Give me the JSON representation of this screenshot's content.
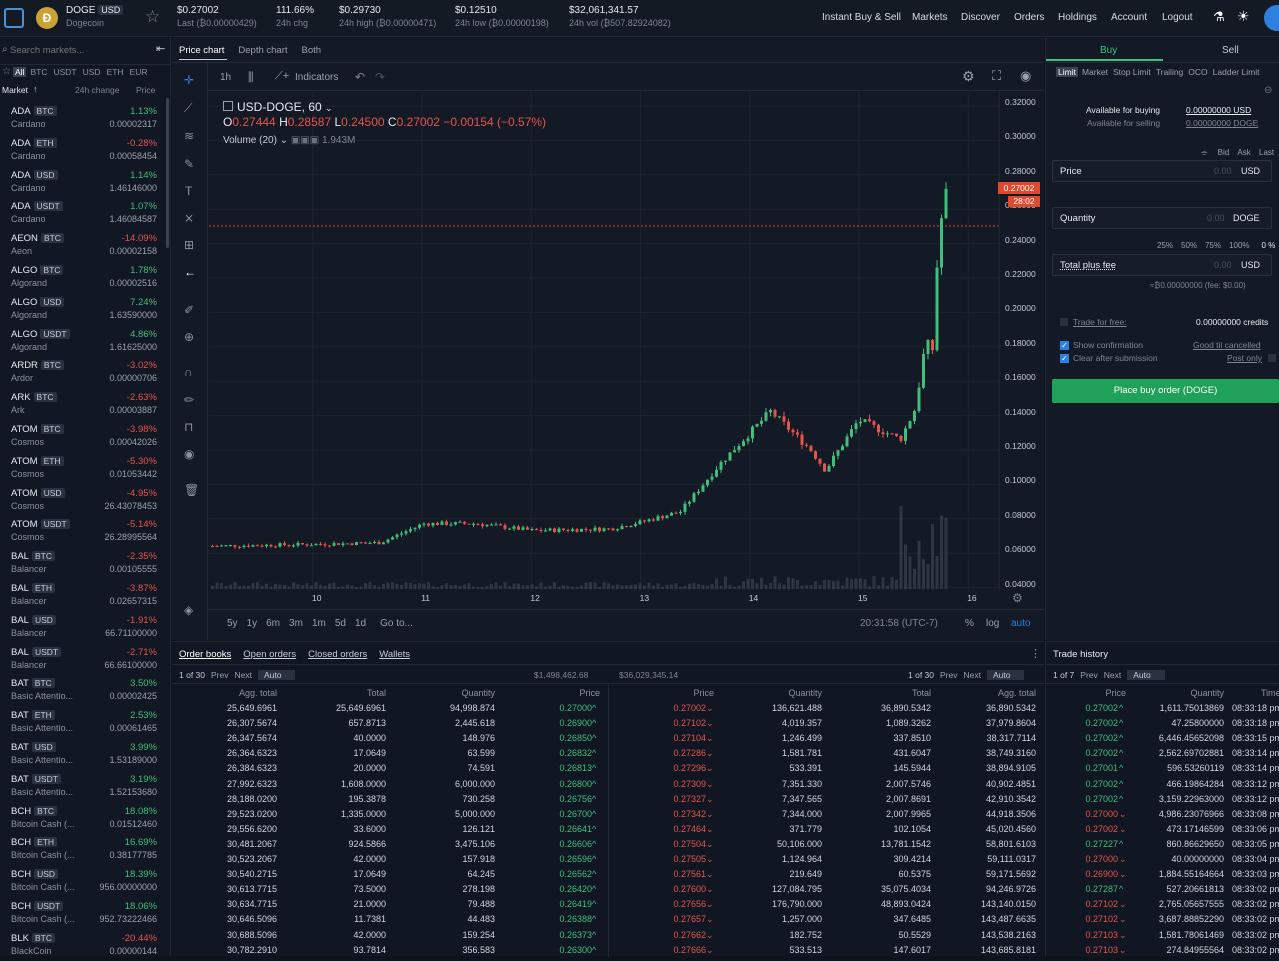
{
  "top": {
    "pair": "DOGE",
    "quote": "USD",
    "coin": "Dogecoin",
    "price": "$0.27002",
    "price_sub": "Last (₿0.00000429)",
    "chg": "111.66%",
    "chg_sub": "24h chg",
    "high": "$0.29730",
    "high_sub": "24h high (₿0.00000471)",
    "low": "$0.12510",
    "low_sub": "24h low (₿0.00000198)",
    "vol": "$32,061,341.57",
    "vol_sub": "24h vol (₿507.82924082)",
    "nav": [
      "Instant Buy & Sell",
      "Markets",
      "Discover",
      "Orders",
      "Holdings",
      "Account",
      "Logout"
    ]
  },
  "left": {
    "search_placeholder": "Search markets...",
    "filters": [
      "All",
      "BTC",
      "USDT",
      "USD",
      "ETH",
      "EUR"
    ],
    "col_market": "Market",
    "col_chg": "24h change",
    "col_price": "Price",
    "markets": [
      {
        "sym": "ADA",
        "q": "BTC",
        "name": "Cardano",
        "chg": "1.13%",
        "price": "0.00002317",
        "up": true
      },
      {
        "sym": "ADA",
        "q": "ETH",
        "name": "Cardano",
        "chg": "-0.28%",
        "price": "0.00058454",
        "up": false
      },
      {
        "sym": "ADA",
        "q": "USD",
        "name": "Cardano",
        "chg": "1.14%",
        "price": "1.46146000",
        "up": true
      },
      {
        "sym": "ADA",
        "q": "USDT",
        "name": "Cardano",
        "chg": "1.07%",
        "price": "1.46084587",
        "up": true
      },
      {
        "sym": "AEON",
        "q": "BTC",
        "name": "Aeon",
        "chg": "-14.09%",
        "price": "0.00002158",
        "up": false
      },
      {
        "sym": "ALGO",
        "q": "BTC",
        "name": "Algorand",
        "chg": "1.78%",
        "price": "0.00002516",
        "up": true
      },
      {
        "sym": "ALGO",
        "q": "USD",
        "name": "Algorand",
        "chg": "7.24%",
        "price": "1.63590000",
        "up": true
      },
      {
        "sym": "ALGO",
        "q": "USDT",
        "name": "Algorand",
        "chg": "4.86%",
        "price": "1.61625000",
        "up": true
      },
      {
        "sym": "ARDR",
        "q": "BTC",
        "name": "Ardor",
        "chg": "-3.02%",
        "price": "0.00000706",
        "up": false
      },
      {
        "sym": "ARK",
        "q": "BTC",
        "name": "Ark",
        "chg": "-2.63%",
        "price": "0.00003887",
        "up": false
      },
      {
        "sym": "ATOM",
        "q": "BTC",
        "name": "Cosmos",
        "chg": "-3.98%",
        "price": "0.00042026",
        "up": false
      },
      {
        "sym": "ATOM",
        "q": "ETH",
        "name": "Cosmos",
        "chg": "-5.30%",
        "price": "0.01053442",
        "up": false
      },
      {
        "sym": "ATOM",
        "q": "USD",
        "name": "Cosmos",
        "chg": "-4.95%",
        "price": "26.43078453",
        "up": false
      },
      {
        "sym": "ATOM",
        "q": "USDT",
        "name": "Cosmos",
        "chg": "-5.14%",
        "price": "26.28995564",
        "up": false
      },
      {
        "sym": "BAL",
        "q": "BTC",
        "name": "Balancer",
        "chg": "-2.35%",
        "price": "0.00105555",
        "up": false
      },
      {
        "sym": "BAL",
        "q": "ETH",
        "name": "Balancer",
        "chg": "-3.87%",
        "price": "0.02657315",
        "up": false
      },
      {
        "sym": "BAL",
        "q": "USD",
        "name": "Balancer",
        "chg": "-1.91%",
        "price": "66.71100000",
        "up": false
      },
      {
        "sym": "BAL",
        "q": "USDT",
        "name": "Balancer",
        "chg": "-2.71%",
        "price": "66.66100000",
        "up": false
      },
      {
        "sym": "BAT",
        "q": "BTC",
        "name": "Basic Attentio...",
        "chg": "3.50%",
        "price": "0.00002425",
        "up": true
      },
      {
        "sym": "BAT",
        "q": "ETH",
        "name": "Basic Attentio...",
        "chg": "2.53%",
        "price": "0.00061465",
        "up": true
      },
      {
        "sym": "BAT",
        "q": "USD",
        "name": "Basic Attentio...",
        "chg": "3.99%",
        "price": "1.53189000",
        "up": true
      },
      {
        "sym": "BAT",
        "q": "USDT",
        "name": "Basic Attentio...",
        "chg": "3.19%",
        "price": "1.52153680",
        "up": true
      },
      {
        "sym": "BCH",
        "q": "BTC",
        "name": "Bitcoin Cash (...",
        "chg": "18.08%",
        "price": "0.01512460",
        "up": true
      },
      {
        "sym": "BCH",
        "q": "ETH",
        "name": "Bitcoin Cash (...",
        "chg": "16.69%",
        "price": "0.38177785",
        "up": true
      },
      {
        "sym": "BCH",
        "q": "USD",
        "name": "Bitcoin Cash (...",
        "chg": "18.39%",
        "price": "956.00000000",
        "up": true
      },
      {
        "sym": "BCH",
        "q": "USDT",
        "name": "Bitcoin Cash (...",
        "chg": "18.06%",
        "price": "952.73222466",
        "up": true
      },
      {
        "sym": "BLK",
        "q": "BTC",
        "name": "BlackCoin",
        "chg": "-20.44%",
        "price": "0.00000144",
        "up": false
      }
    ]
  },
  "chart": {
    "tabs": [
      "Price chart",
      "Depth chart",
      "Both"
    ],
    "interval": "1h",
    "indicators": "Indicators",
    "symbol": "USD-DOGE, 60",
    "o": "0.27444",
    "h": "0.28587",
    "l": "0.24500",
    "c": "0.27002",
    "delta": "−0.00154 (−0.57%)",
    "volume": "Volume (20)",
    "volume_val": "1.943M",
    "last_tag": "0.27002",
    "timer": "28:02",
    "ranges": [
      "5y",
      "1y",
      "6m",
      "3m",
      "1m",
      "5d",
      "1d"
    ],
    "goto": "Go to...",
    "clock": "20:31:58 (UTC-7)",
    "pct": "%",
    "log": "log",
    "auto": "auto",
    "yticks": [
      "0.32000",
      "0.30000",
      "0.28000",
      "0.26000",
      "0.24000",
      "0.22000",
      "0.20000",
      "0.18000",
      "0.16000",
      "0.14000",
      "0.12000",
      "0.10000",
      "0.08000",
      "0.06000",
      "0.04000"
    ],
    "xticks": [
      "10",
      "11",
      "12",
      "13",
      "14",
      "15",
      "16"
    ]
  },
  "chart_data": {
    "type": "candlestick",
    "series": [
      {
        "x": "10",
        "open": 0.063,
        "close": 0.063
      },
      {
        "x": "11",
        "open": 0.071,
        "close": 0.075
      },
      {
        "x": "12",
        "open": 0.07,
        "close": 0.071
      },
      {
        "x": "13",
        "open": 0.074,
        "close": 0.076
      },
      {
        "x": "14",
        "open": 0.114,
        "close": 0.128
      },
      {
        "x": "15",
        "open": 0.137,
        "close": 0.135
      },
      {
        "x": "16",
        "open": 0.27444,
        "close": 0.27002
      }
    ],
    "ylim": [
      0.04,
      0.32
    ],
    "last": 0.27002
  },
  "trade": {
    "buy": "Buy",
    "sell": "Sell",
    "types": [
      "Limit",
      "Market",
      "Stop Limit",
      "Trailing",
      "OCO",
      "Ladder Limit"
    ],
    "avail_buy_l": "Available for buying",
    "avail_buy": "0.00000000 USD",
    "avail_sell_l": "Available for selling",
    "avail_sell": "0.00000000 DOGE",
    "bal": [
      "Bid",
      "Ask",
      "Last"
    ],
    "price_l": "Price",
    "price_v": "0.00",
    "usd": "USD",
    "qty_l": "Quantity",
    "qty_v": "0.00",
    "doge": "DOGE",
    "pcts": [
      "25%",
      "50%",
      "75%",
      "100%",
      "0 %"
    ],
    "total_l": "Total plus fee",
    "total_v": "0.00",
    "approx": "≈₿0.00000000 (fee: $0.00)",
    "free_l": "Trade for free:",
    "free_v": "0.00000000 credits",
    "show_conf": "Show confirmation",
    "clear": "Clear after submission",
    "gtc": "Good til cancelled",
    "post": "Post only",
    "place": "Place buy order (DOGE)"
  },
  "ob": {
    "tabs": [
      "Order books",
      "Open orders",
      "Closed orders",
      "Wallets"
    ],
    "page": "1 of 30",
    "prev": "Prev",
    "next": "Next",
    "auto": "Auto",
    "sum_l": "$1,498,462.68",
    "sum_r": "$36,029,345.14",
    "h_agg": "Agg. total",
    "h_total": "Total",
    "h_qty": "Quantity",
    "h_price": "Price",
    "bids": [
      [
        "25,649.6961",
        "25,649.6961",
        "94,998.874",
        "0.27000"
      ],
      [
        "26,307.5674",
        "657.8713",
        "2,445.618",
        "0.26900"
      ],
      [
        "26,347.5674",
        "40.0000",
        "148.976",
        "0.26850"
      ],
      [
        "26,364.6323",
        "17.0649",
        "63.599",
        "0.26832"
      ],
      [
        "26,384.6323",
        "20.0000",
        "74.591",
        "0.26813"
      ],
      [
        "27,992.6323",
        "1,608.0000",
        "6,000.000",
        "0.26800"
      ],
      [
        "28,188.0200",
        "195.3878",
        "730.258",
        "0.26756"
      ],
      [
        "29,523.0200",
        "1,335.0000",
        "5,000.000",
        "0.26700"
      ],
      [
        "29,556.6200",
        "33.6000",
        "126.121",
        "0.26641"
      ],
      [
        "30,481.2067",
        "924.5866",
        "3,475.106",
        "0.26606"
      ],
      [
        "30,523.2067",
        "42.0000",
        "157.918",
        "0.26596"
      ],
      [
        "30,540.2715",
        "17.0649",
        "64.245",
        "0.26562"
      ],
      [
        "30,613.7715",
        "73.5000",
        "278.198",
        "0.26420"
      ],
      [
        "30,634.7715",
        "21.0000",
        "79.488",
        "0.26419"
      ],
      [
        "30,646.5096",
        "11.7381",
        "44.483",
        "0.26388"
      ],
      [
        "30,688.5096",
        "42.0000",
        "159.254",
        "0.26373"
      ],
      [
        "30,782.2910",
        "93.7814",
        "356.583",
        "0.26300"
      ]
    ],
    "asks": [
      [
        "0.27002",
        "136,621.488",
        "36,890.5342",
        "36,890.5342"
      ],
      [
        "0.27102",
        "4,019.357",
        "1,089.3262",
        "37,979.8604"
      ],
      [
        "0.27104",
        "1,246.499",
        "337.8510",
        "38,317.7114"
      ],
      [
        "0.27286",
        "1,581.781",
        "431.6047",
        "38,749.3160"
      ],
      [
        "0.27296",
        "533.391",
        "145.5944",
        "38,894.9105"
      ],
      [
        "0.27309",
        "7,351.330",
        "2,007.5746",
        "40,902.4851"
      ],
      [
        "0.27327",
        "7,347.565",
        "2,007.8691",
        "42,910.3542"
      ],
      [
        "0.27342",
        "7,344.000",
        "2,007.9965",
        "44,918.3506"
      ],
      [
        "0.27464",
        "371.779",
        "102.1054",
        "45,020.4560"
      ],
      [
        "0.27504",
        "50,106.000",
        "13,781.1542",
        "58,801.6103"
      ],
      [
        "0.27505",
        "1,124.964",
        "309.4214",
        "59,111.0317"
      ],
      [
        "0.27561",
        "219.649",
        "60.5375",
        "59,171.5692"
      ],
      [
        "0.27600",
        "127,084.795",
        "35,075.4034",
        "94,246.9726"
      ],
      [
        "0.27656",
        "176,790.000",
        "48,893.0424",
        "143,140.0150"
      ],
      [
        "0.27657",
        "1,257.000",
        "347.6485",
        "143,487.6635"
      ],
      [
        "0.27662",
        "182.752",
        "50.5529",
        "143,538.2163"
      ],
      [
        "0.27666",
        "533.513",
        "147.6017",
        "143,685.8181"
      ]
    ]
  },
  "hist": {
    "title": "Trade history",
    "page": "1 of 7",
    "prev": "Prev",
    "next": "Next",
    "auto": "Auto",
    "h_price": "Price",
    "h_qty": "Quantity",
    "h_time": "Time",
    "rows": [
      [
        "0.27002",
        "1,611.75013869",
        "08:33:18 pm",
        true
      ],
      [
        "0.27002",
        "47.25800000",
        "08:33:18 pm",
        true
      ],
      [
        "0.27002",
        "6,446.45652098",
        "08:33:15 pm",
        true
      ],
      [
        "0.27002",
        "2,562.69702881",
        "08:33:14 pm",
        true
      ],
      [
        "0.27001",
        "596.53260119",
        "08:33:14 pm",
        true
      ],
      [
        "0.27002",
        "466.19864284",
        "08:33:12 pm",
        true
      ],
      [
        "0.27002",
        "3,159.22963000",
        "08:33:12 pm",
        true
      ],
      [
        "0.27000",
        "4,986.23076966",
        "08:33:08 pm",
        false
      ],
      [
        "0.27002",
        "473.17146599",
        "08:33:06 pm",
        false
      ],
      [
        "0.27227",
        "860.86629650",
        "08:33:05 pm",
        true
      ],
      [
        "0.27000",
        "40.00000000",
        "08:33:04 pm",
        false
      ],
      [
        "0.26900",
        "1,884.55164664",
        "08:33:03 pm",
        false
      ],
      [
        "0.27287",
        "527.20661813",
        "08:33:02 pm",
        true
      ],
      [
        "0.27102",
        "2,765.05657555",
        "08:33:02 pm",
        false
      ],
      [
        "0.27102",
        "3,687.88852290",
        "08:33:02 pm",
        false
      ],
      [
        "0.27103",
        "1,581.78061469",
        "08:33:02 pm",
        false
      ],
      [
        "0.27103",
        "274.84955564",
        "08:33:02 pm",
        false
      ]
    ]
  }
}
